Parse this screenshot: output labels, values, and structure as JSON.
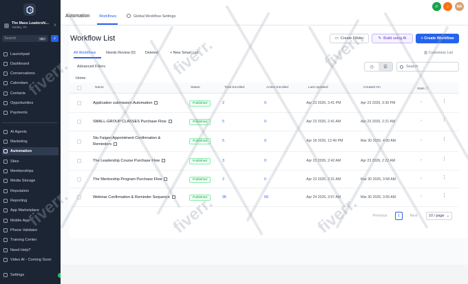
{
  "sidebar": {
    "account": {
      "name": "The Mass Leadershi...",
      "location": "Yardley, PA"
    },
    "search": {
      "label": "Search",
      "shortcut": "⌘K"
    },
    "bolt_icon": "⚡",
    "items": [
      {
        "label": "Launchpad"
      },
      {
        "label": "Dashboard"
      },
      {
        "label": "Conversations"
      },
      {
        "label": "Calendars"
      },
      {
        "label": "Contacts"
      },
      {
        "label": "Opportunities"
      },
      {
        "label": "Payments"
      },
      {
        "label": "AI Agents"
      },
      {
        "label": "Marketing"
      },
      {
        "label": "Automation",
        "active": true
      },
      {
        "label": "Sites"
      },
      {
        "label": "Memberships"
      },
      {
        "label": "Media Storage"
      },
      {
        "label": "Reputation"
      },
      {
        "label": "Reporting"
      },
      {
        "label": "App Marketplace"
      },
      {
        "label": "Mobile App"
      },
      {
        "label": "Phone Validator"
      },
      {
        "label": "Training Center"
      },
      {
        "label": "Need Help?"
      },
      {
        "label": "Video AI - Coming Soon"
      },
      {
        "label": "Settings"
      }
    ]
  },
  "topbar": {
    "title": "Automation",
    "tabs": [
      {
        "label": "Workflows"
      },
      {
        "label": "Global Workflow Settings"
      }
    ],
    "avatar_initials": "MA",
    "colors": {
      "phone": "#16a34a",
      "bell": "#f97316",
      "avatar": "#d4a373"
    }
  },
  "main": {
    "title": "Workflow List",
    "buttons": {
      "create_folder": "Create Folder",
      "build_ai": "Build using AI",
      "create_workflow": "+ Create Workflow"
    },
    "subtabs": [
      "All Workflows",
      "Needs Review (0)",
      "Deleted",
      "New Smart List"
    ],
    "customize": "Customize List",
    "advanced_filters": "Advanced Filters",
    "search_placeholder": "Search",
    "breadcrumb": "Home"
  },
  "table": {
    "columns": [
      "Name",
      "Status",
      "Total Enrolled",
      "Active Enrolled",
      "Last Updated",
      "Created On",
      "Stats"
    ],
    "rows": [
      {
        "name": "Application submission Automation",
        "status": "Published",
        "total": "2",
        "active": "0",
        "updated": "Apr 23 2026, 3:41 PM",
        "created": "Apr 23 2026, 3:30 PM"
      },
      {
        "name": "SMALL-GROUP CLASSES Purchase Flow",
        "status": "Published",
        "total": "5",
        "active": "0",
        "updated": "Apr 23 2026, 2:41 AM",
        "created": "Apr 23 2026, 2:21 AM"
      },
      {
        "name": "Stu Faigen Appointment Confirmation & Reminders",
        "status": "Published",
        "total": "5",
        "active": "0",
        "updated": "Apr 18 2026, 12:49 PM",
        "created": "Mar 30 2026, 4:00 AM"
      },
      {
        "name": "The Leadership Course Purchase Flow",
        "status": "Published",
        "total": "3",
        "active": "0",
        "updated": "Apr 23 2026, 2:42 AM",
        "created": "Apr 23 2026, 2:22 AM"
      },
      {
        "name": "The Mentorship Program Purchase Flow",
        "status": "Published",
        "total": "2",
        "active": "0",
        "updated": "Apr 23 2026, 2:31 AM",
        "created": "Mar 30 2026, 3:58 AM"
      },
      {
        "name": "Webinar Confirmation & Reminder Sequence",
        "status": "Published",
        "total": "96",
        "active": "69",
        "updated": "Apr 24 2026, 3:57 AM",
        "created": "Mar 30 2026, 3:55 AM"
      }
    ]
  },
  "pagination": {
    "previous": "Previous",
    "page": "1",
    "next": "Next",
    "page_size": "10 / page"
  },
  "watermark": "fiverr."
}
